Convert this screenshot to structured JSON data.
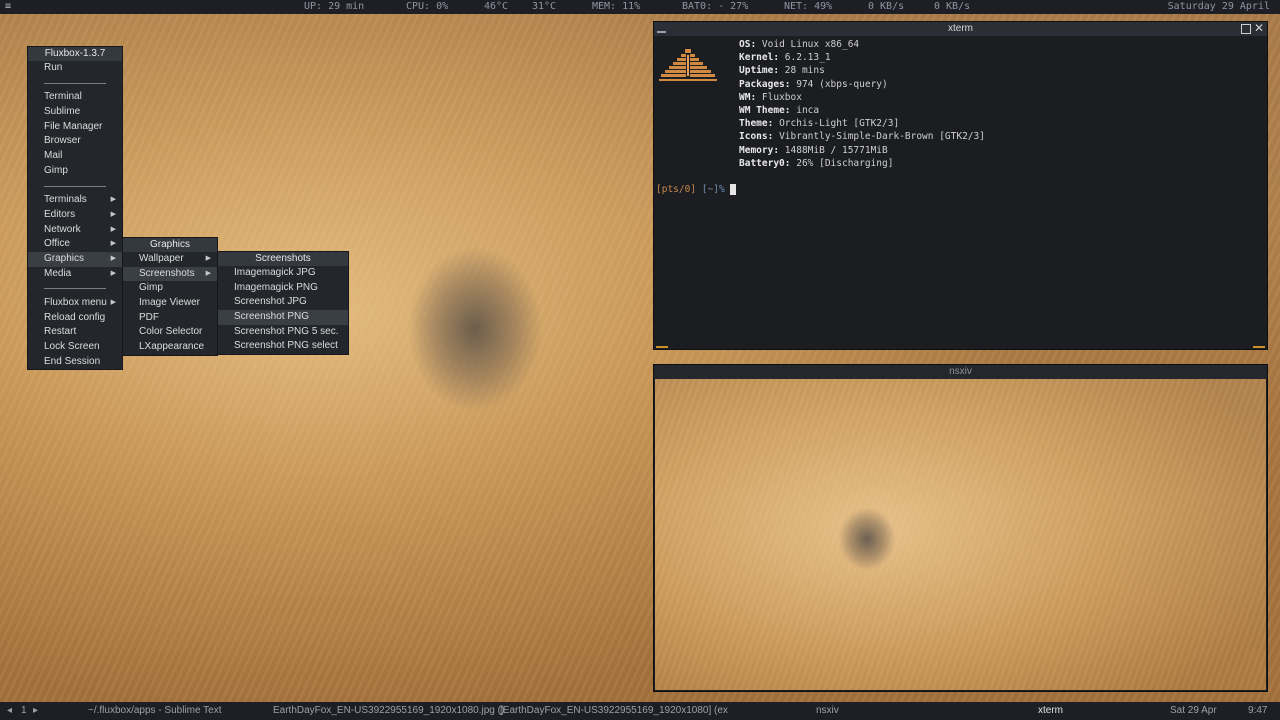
{
  "topbar": {
    "uptime": "UP: 29 min",
    "cpu": "CPU:  0%",
    "temp1": "46°C",
    "temp2": "31°C",
    "mem": "MEM: 11%",
    "bat": "BAT0: - 27%",
    "net": "NET:  49%",
    "down": "0 KB/s",
    "up": "0 KB/s",
    "date": "Saturday 29 April"
  },
  "root_menu": {
    "title": "Fluxbox-1.3.7",
    "items": {
      "run": "Run",
      "terminal": "Terminal",
      "sublime": "Sublime",
      "file_manager": "File Manager",
      "browser": "Browser",
      "mail": "Mail",
      "gimp": "Gimp",
      "terminals": "Terminals",
      "editors": "Editors",
      "network": "Network",
      "office": "Office",
      "graphics": "Graphics",
      "media": "Media",
      "fluxbox_menu": "Fluxbox menu",
      "reload_config": "Reload config",
      "restart": "Restart",
      "lock_screen": "Lock Screen",
      "end_session": "End Session"
    }
  },
  "graphics_menu": {
    "title": "Graphics",
    "items": [
      "Wallpaper",
      "Screenshots",
      "Gimp",
      "Image Viewer",
      "PDF",
      "Color Selector",
      "LXappearance"
    ]
  },
  "screenshots_menu": {
    "title": "Screenshots",
    "items": [
      "Imagemagick JPG",
      "Imagemagick PNG",
      "Screenshot JPG",
      "Screenshot PNG",
      "Screenshot PNG 5 sec.",
      "Screenshot PNG select"
    ]
  },
  "xterm": {
    "title": "xterm",
    "info": [
      {
        "key": "OS:",
        "value": "Void Linux x86_64"
      },
      {
        "key": "Kernel:",
        "value": "6.2.13_1"
      },
      {
        "key": "Uptime:",
        "value": "28 mins"
      },
      {
        "key": "Packages:",
        "value": "974 (xbps-query)"
      },
      {
        "key": "WM:",
        "value": "Fluxbox"
      },
      {
        "key": "WM Theme:",
        "value": "inca"
      },
      {
        "key": "Theme:",
        "value": "Orchis-Light [GTK2/3]"
      },
      {
        "key": "Icons:",
        "value": "Vibrantly-Simple-Dark-Brown [GTK2/3]"
      },
      {
        "key": "Memory:",
        "value": "1488MiB / 15771MiB"
      },
      {
        "key": "Battery0:",
        "value": "26% [Discharging]"
      }
    ],
    "prompt_pts": "[pts/0]",
    "prompt_dir": "[~]%"
  },
  "nsxiv": {
    "title": "nsxiv"
  },
  "bottombar": {
    "prev": "◂",
    "workspace": "1",
    "next": "▸",
    "tasks": [
      "~/.fluxbox/apps - Sublime Text",
      "EarthDayFox_EN-US3922955169_1920x1080.jpg ()",
      "[EarthDayFox_EN-US3922955169_1920x1080] (ex",
      "nsxiv",
      "xterm"
    ],
    "date": "Sat 29 Apr",
    "time": "9:47"
  },
  "colors": {
    "bar_bg": "#1d1f24",
    "menu_bg": "#23262b",
    "accent": "#c9912e",
    "prompt_pts": "#c88a4b",
    "prompt_dir": "#6e8fb5"
  }
}
